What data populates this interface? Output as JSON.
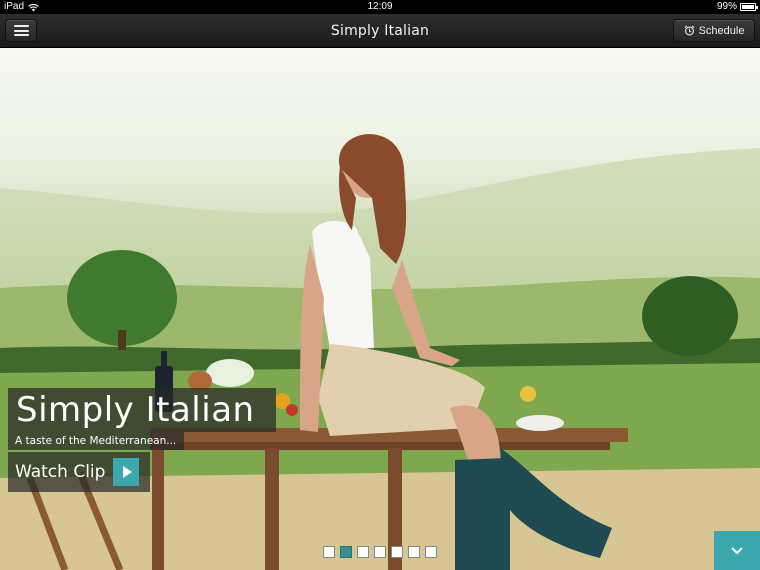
{
  "status_bar": {
    "device": "iPad",
    "time": "12:09",
    "battery": "99%",
    "icons": [
      "wifi-icon",
      "battery-icon"
    ]
  },
  "nav": {
    "title": "Simply Italian",
    "menu_icon": "hamburger-icon",
    "schedule_label": "Schedule",
    "schedule_icon": "alarm-clock-icon"
  },
  "hero": {
    "title": "Simply Italian",
    "subtitle": "A taste of the Mediterranean...",
    "watch_clip_label": "Watch Clip",
    "play_icon": "play-icon"
  },
  "pager": {
    "count": 7,
    "active_index": 1
  },
  "expand_icon": "chevron-down-icon",
  "colors": {
    "accent": "#3aa8ad",
    "nav_bg": "#222222",
    "overlay_bg": "#282828"
  }
}
